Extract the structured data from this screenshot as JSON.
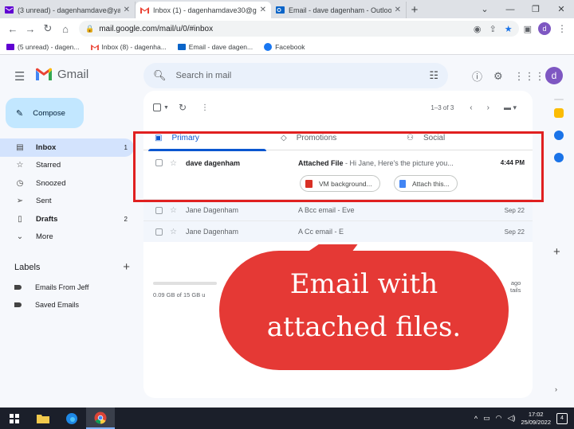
{
  "browser": {
    "tabs": [
      {
        "title": "(3 unread) - dagenhamdave@yahoo.com",
        "active": false,
        "icon": "yahoo-mail-icon"
      },
      {
        "title": "Inbox (1) - dagenhamdave30@gmail.com",
        "active": true,
        "icon": "gmail-icon"
      },
      {
        "title": "Email - dave dagenham - Outlook",
        "active": false,
        "icon": "outlook-icon"
      }
    ],
    "new_tab": "+",
    "url": "mail.google.com/mail/u/0/#inbox",
    "profile_initial": "d",
    "bookmarks": [
      {
        "label": "(5 unread) - dagen...",
        "icon": "yahoo-mail-icon"
      },
      {
        "label": "Inbox (8) - dagenha...",
        "icon": "gmail-icon"
      },
      {
        "label": "Email - dave dagen...",
        "icon": "outlook-icon"
      },
      {
        "label": "Facebook",
        "icon": "facebook-icon"
      }
    ]
  },
  "gmail": {
    "logo_text": "Gmail",
    "search_placeholder": "Search in mail",
    "avatar_initial": "d",
    "compose_label": "Compose",
    "nav": [
      {
        "label": "Inbox",
        "count": "1",
        "icon": "inbox-icon",
        "active": true
      },
      {
        "label": "Starred",
        "count": "",
        "icon": "star-icon"
      },
      {
        "label": "Snoozed",
        "count": "",
        "icon": "clock-icon"
      },
      {
        "label": "Sent",
        "count": "",
        "icon": "send-icon"
      },
      {
        "label": "Drafts",
        "count": "2",
        "icon": "draft-icon"
      },
      {
        "label": "More",
        "count": "",
        "icon": "chevron-down-icon"
      }
    ],
    "labels_title": "Labels",
    "labels": [
      "Emails From Jeff",
      "Saved Emails"
    ],
    "pagination": "1–3 of 3",
    "categories": [
      {
        "label": "Primary",
        "active": true
      },
      {
        "label": "Promotions",
        "active": false
      },
      {
        "label": "Social",
        "active": false
      }
    ],
    "emails": [
      {
        "sender": "dave dagenham",
        "subject": "Attached File",
        "snippet": " - Hi Jane, Here's the picture you...",
        "date": "4:44 PM",
        "unread": true,
        "attachments": [
          "VM background...",
          "Attach this..."
        ]
      },
      {
        "sender": "Jane Dagenham",
        "subject": "A Bcc email",
        "snippet": " - Eve",
        "date": "Sep 22",
        "unread": false
      },
      {
        "sender": "Jane Dagenham",
        "subject": "A Cc email",
        "snippet": " - E",
        "date": "Sep 22",
        "unread": false
      }
    ],
    "storage_text": "0.09 GB of 15 GB u",
    "activity_lines": [
      "ago",
      "tails"
    ]
  },
  "annotation": {
    "callout_lines": [
      "Email with",
      "attached files."
    ],
    "color": "#e53935"
  },
  "taskbar": {
    "time": "17:02",
    "date": "25/09/2022",
    "notification_count": "4"
  }
}
